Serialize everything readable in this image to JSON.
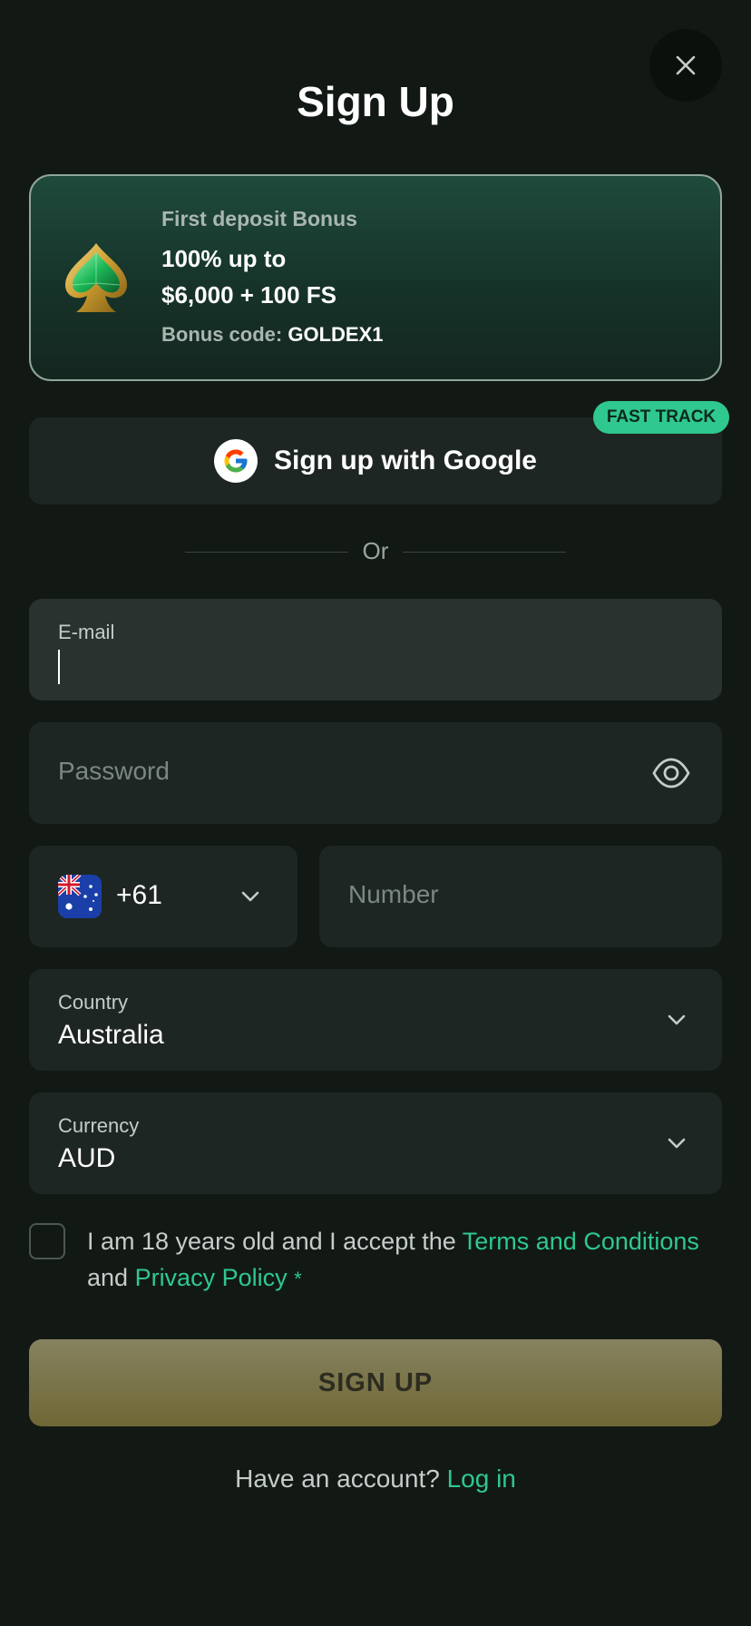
{
  "header": {
    "title": "Sign Up",
    "close_icon": "close-icon"
  },
  "bonus": {
    "label": "First deposit Bonus",
    "line1": "100% up to",
    "line2": "$6,000 + 100 FS",
    "code_prefix": "Bonus code:",
    "code": "GOLDEX1",
    "icon": "emerald-spade-icon"
  },
  "google": {
    "label": "Sign up with Google",
    "badge": "FAST TRACK",
    "icon": "google-icon"
  },
  "divider": {
    "text": "Or"
  },
  "form": {
    "email": {
      "label": "E-mail",
      "value": ""
    },
    "password": {
      "placeholder": "Password",
      "icon": "eye-icon"
    },
    "phone": {
      "code": "+61",
      "flag": "australia-flag-icon",
      "placeholder": "Number"
    },
    "country": {
      "label": "Country",
      "value": "Australia"
    },
    "currency": {
      "label": "Currency",
      "value": "AUD"
    }
  },
  "terms": {
    "text_before": "I am 18 years old and I accept the ",
    "terms_link": "Terms and Conditions",
    "text_mid": "and ",
    "privacy_link": "Privacy Policy",
    "required": "*",
    "checked": false
  },
  "submit": {
    "label": "SIGN UP"
  },
  "footer": {
    "prompt": "Have an account?",
    "login_link": "Log in"
  },
  "colors": {
    "accent": "#2fc88e",
    "background": "#121915",
    "field": "#1e2623",
    "button": "#7a7548"
  }
}
